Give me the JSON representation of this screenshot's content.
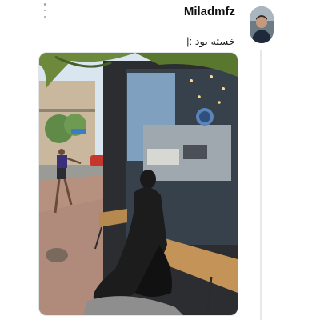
{
  "tweet": {
    "author_name": "Miladmfz",
    "text": "خسته بود :|",
    "menu_icon": "more-vertical-icon"
  },
  "colors": {
    "thread_line": "#e6e9ec",
    "text": "#111111",
    "muted_icon": "#9aa4ad"
  }
}
